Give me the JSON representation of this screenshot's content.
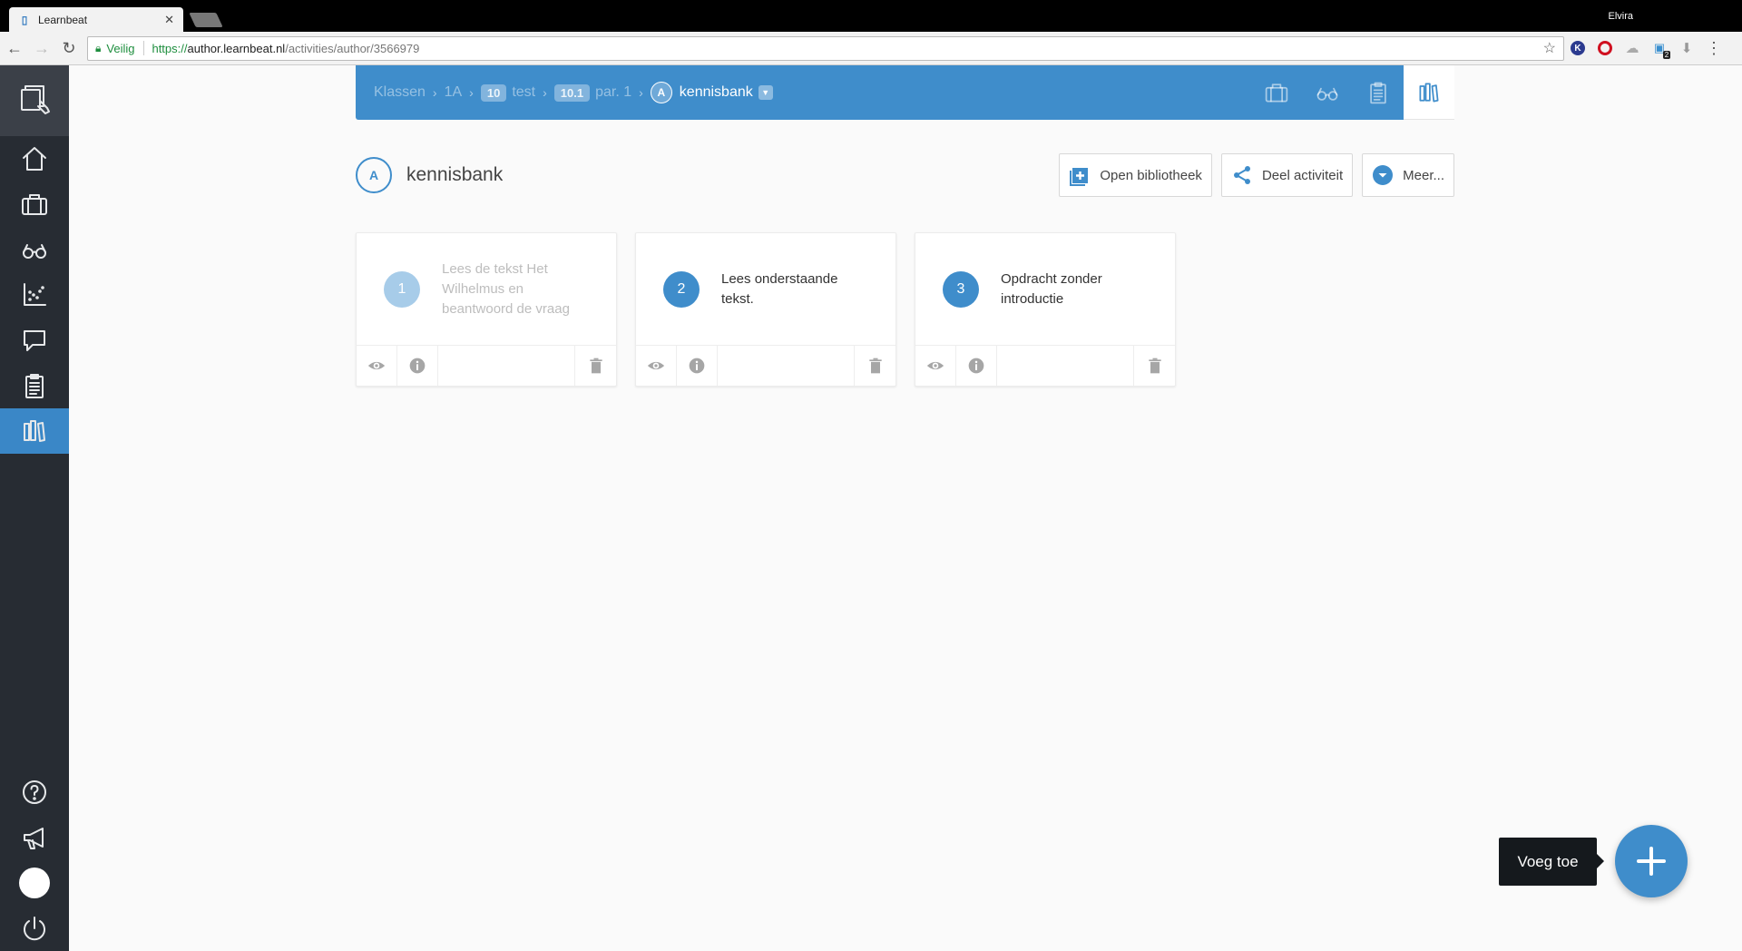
{
  "browser": {
    "tab_title": "Learnbeat",
    "tab_close": "✕",
    "profile_name": "Elvira",
    "secure_label": "Veilig",
    "url_scheme": "https://",
    "url_host": "author.learnbeat.nl",
    "url_path": "/activities/author/3566979"
  },
  "breadcrumb": {
    "items": [
      {
        "label": "Klassen"
      },
      {
        "label": "1A"
      },
      {
        "pill": "10",
        "label": "test"
      },
      {
        "pill": "10.1",
        "label": "par. 1"
      }
    ],
    "current_letter": "A",
    "current_label": "kennisbank"
  },
  "activity": {
    "letter": "A",
    "title": "kennisbank",
    "buttons": {
      "library": "Open bibliotheek",
      "share": "Deel activiteit",
      "more": "Meer..."
    }
  },
  "cards": [
    {
      "number": "1",
      "text": "Lees de tekst Het Wilhelmus en beantwoord de vraag",
      "faded": true
    },
    {
      "number": "2",
      "text": "Lees onderstaande tekst.",
      "faded": false
    },
    {
      "number": "3",
      "text": "Opdracht zonder introductie",
      "faded": false
    }
  ],
  "fab": {
    "tooltip": "Voeg toe"
  },
  "colors": {
    "accent": "#3f8dcb",
    "sidebar": "#272c33",
    "active_nav": "#3a87c7"
  },
  "icons": {
    "sidebar": [
      "author-logo-icon",
      "home-icon",
      "briefcase-icon",
      "glasses-icon",
      "chart-icon",
      "chat-icon",
      "clipboard-icon",
      "library-icon"
    ],
    "sidebar_bottom": [
      "help-icon",
      "megaphone-icon",
      "avatar",
      "power-icon"
    ],
    "breadcrumb_actions": [
      "briefcase-icon",
      "glasses-icon",
      "clipboard-icon",
      "library-icon"
    ]
  }
}
